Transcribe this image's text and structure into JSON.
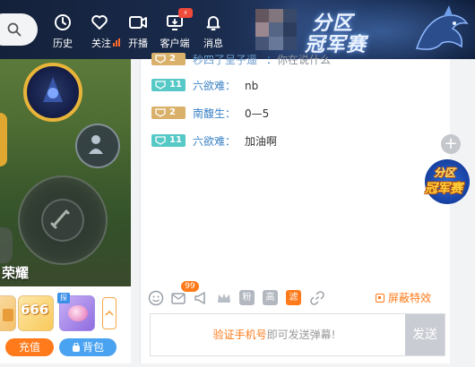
{
  "header": {
    "nav": [
      {
        "label": "历史",
        "icon": "clock-icon"
      },
      {
        "label": "关注",
        "icon": "heart-icon"
      },
      {
        "label": "开播",
        "icon": "camera-icon"
      },
      {
        "label": "客户端",
        "icon": "monitor-download-icon"
      },
      {
        "label": "消息",
        "icon": "bell-icon"
      }
    ],
    "follow_extra_icon": "signal-bars-icon",
    "client_badge_icon": "lightning-icon",
    "event_logo": {
      "line1": "分区",
      "line2": "冠军赛"
    }
  },
  "stream": {
    "title_fragment": "荣耀"
  },
  "gifts": {
    "items": [
      {
        "name": "gift-partial",
        "icon": "gift-icon"
      },
      {
        "name": "gift-666",
        "text": "666"
      },
      {
        "name": "gift-planet",
        "tag": "探"
      }
    ],
    "recharge_label": "充值",
    "bag_label": "背包"
  },
  "chat": {
    "messages": [
      {
        "level": "2",
        "level_color": "tan",
        "nick": "秒四了呈子遥",
        "sep": "：",
        "text": "你在说什么",
        "faded": true
      },
      {
        "level": "11",
        "level_color": "teal",
        "nick": "六欲难",
        "sep": "：",
        "text": "nb"
      },
      {
        "level": "2",
        "level_color": "tan",
        "nick": "南馥生",
        "sep": "：",
        "text": "0—5"
      },
      {
        "level": "11",
        "level_color": "teal",
        "nick": "六欲难",
        "sep": "：",
        "text": "加油啊"
      }
    ],
    "toolbar": {
      "badge_count": "99",
      "fan_label": "粉",
      "high_label": "高",
      "filter_label": "滤",
      "block_effects_label": "屏蔽特效"
    },
    "input": {
      "hint_link": "验证手机号",
      "hint_rest": "即可发送弹幕!",
      "send_label": "发送"
    }
  },
  "promo": {
    "line1": "分区",
    "line2": "冠军赛"
  },
  "colors": {
    "accent_orange": "#ff7a1a",
    "nick_blue": "#3b82c6",
    "level_teal": "#56c9c6",
    "level_tan": "#d9b16a",
    "bag_blue": "#4aa3f0"
  }
}
